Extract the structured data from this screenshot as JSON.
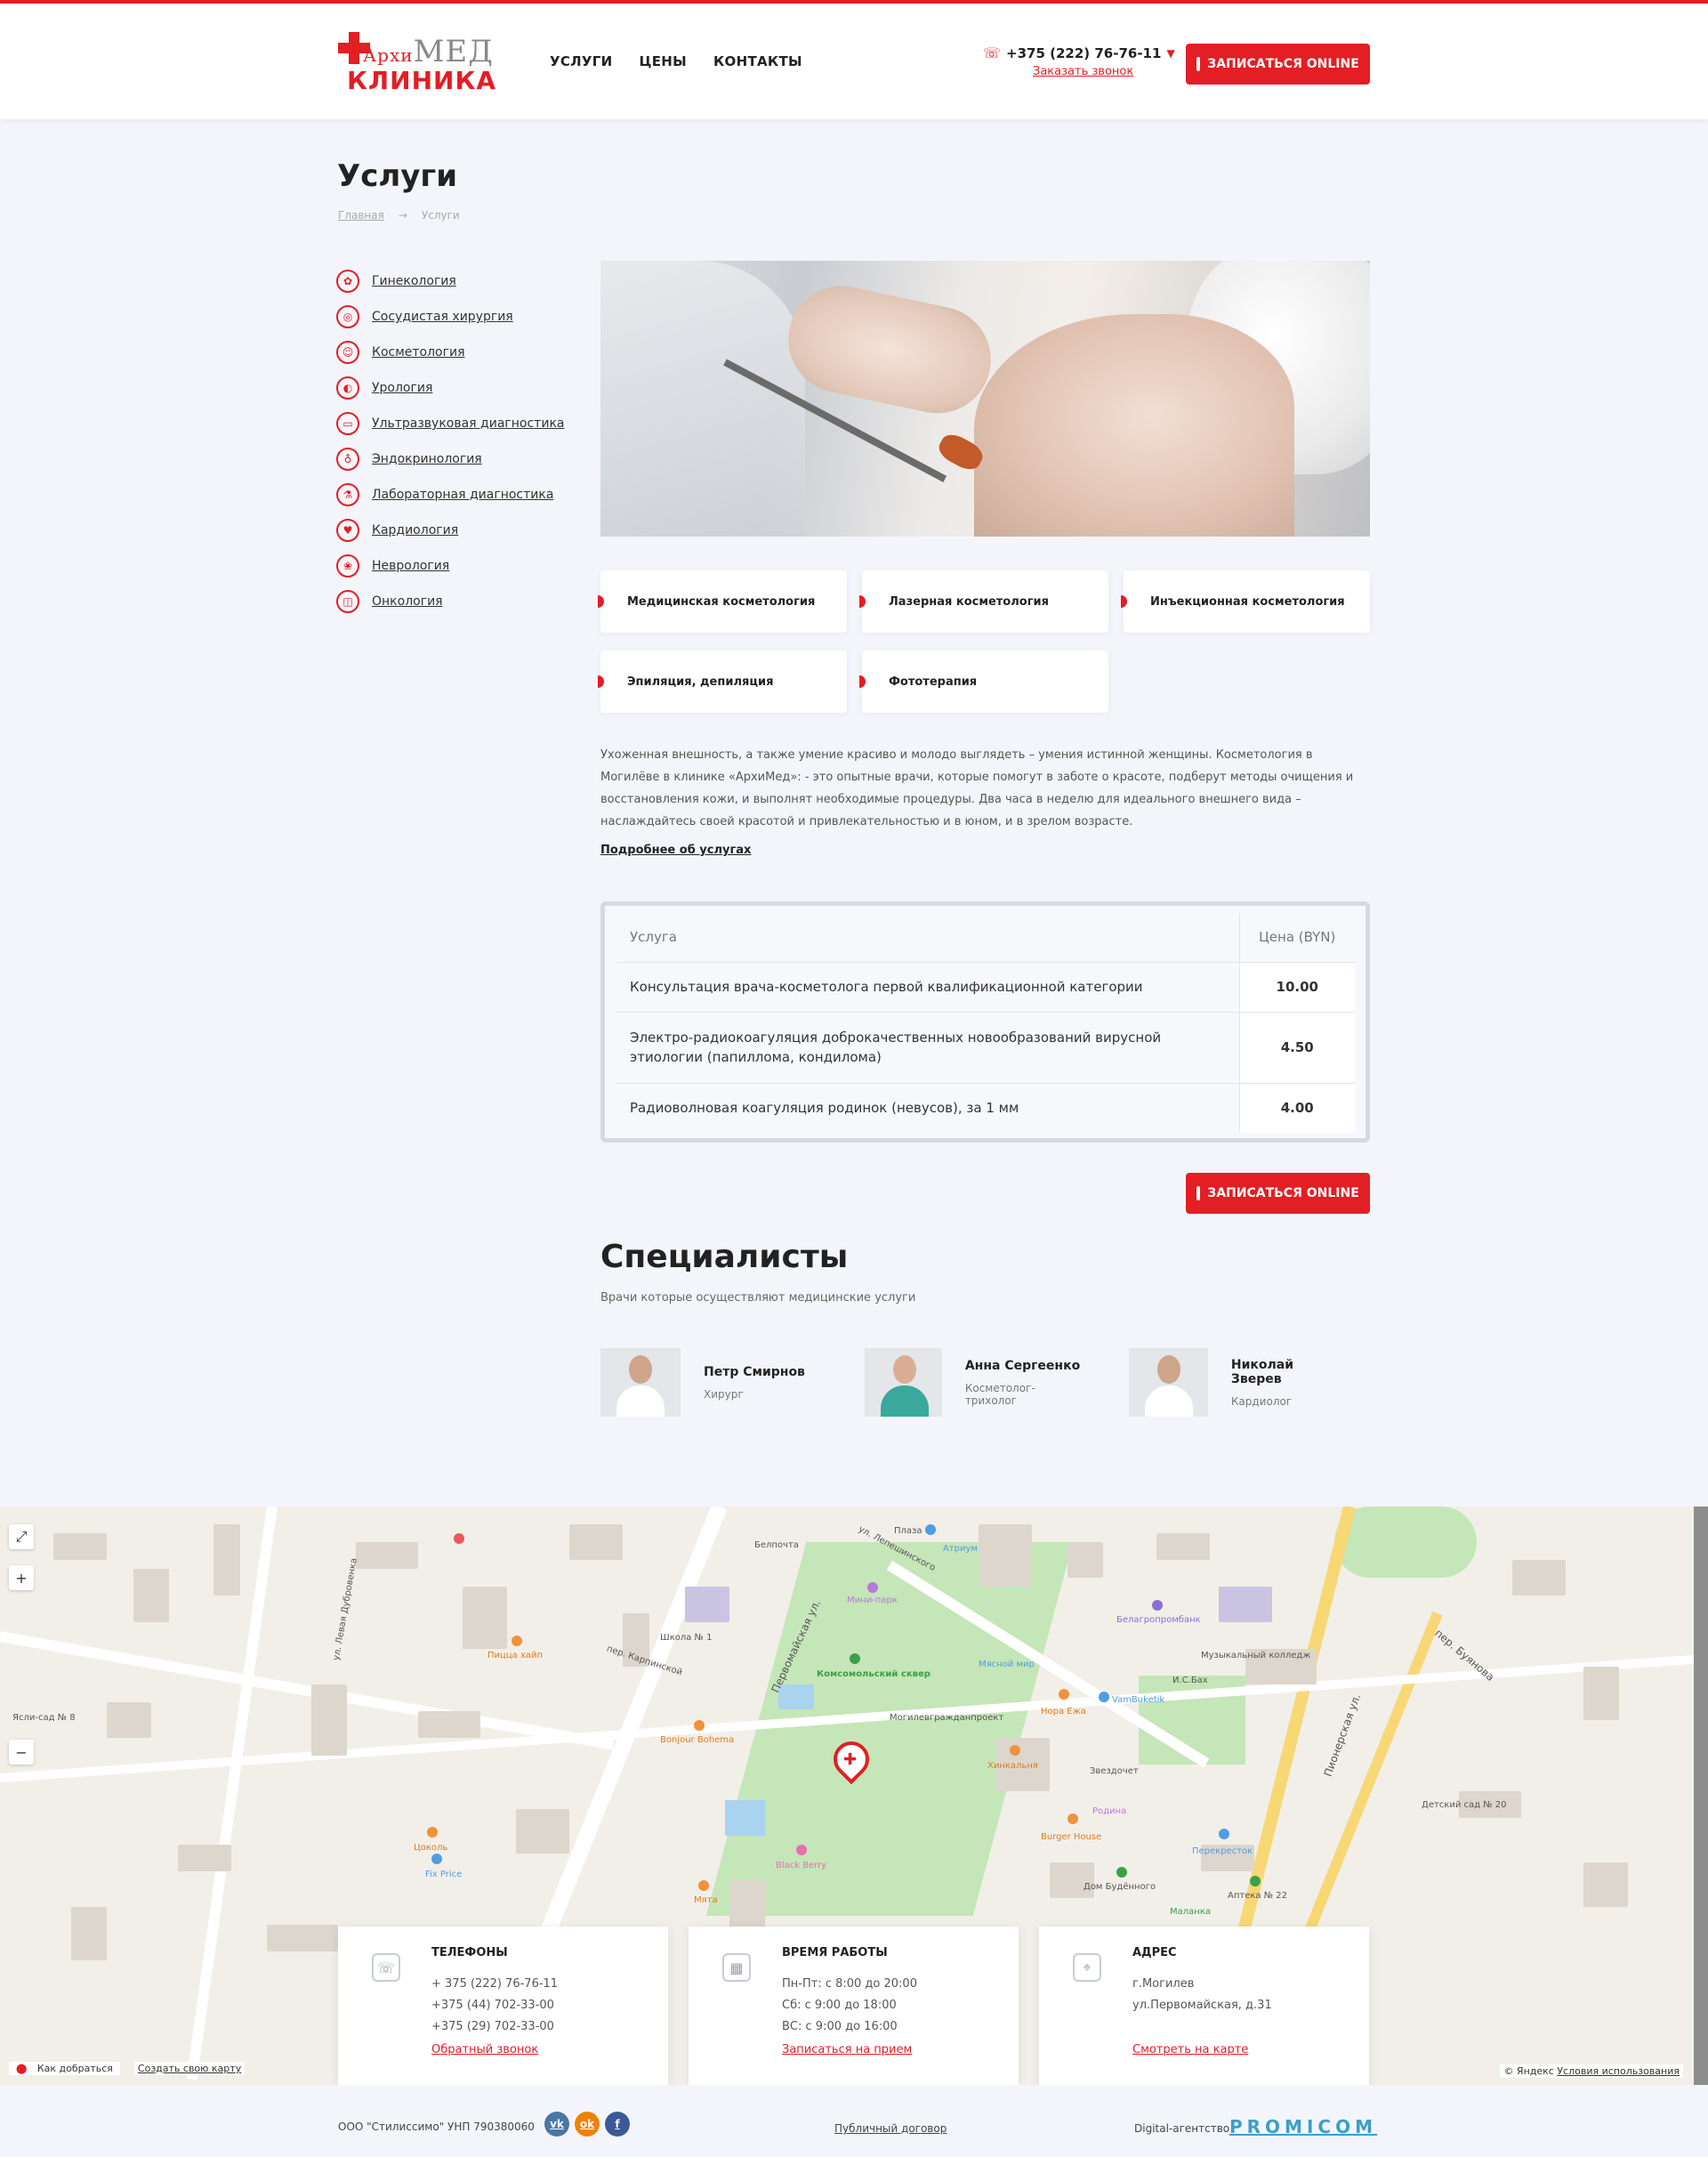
{
  "header": {
    "logo_top": "АрхиМЕД",
    "logo_top_small": "Архи",
    "logo_top_big": "МЕД",
    "logo_bottom": "КЛИНИКА",
    "nav": [
      "УСЛУГИ",
      "ЦЕНЫ",
      "КОНТАКТЫ"
    ],
    "phone": "+375 (222) 76-76-11",
    "callback": "Заказать звонок",
    "cta": "ЗАПИСАТЬСЯ ONLINE"
  },
  "page": {
    "title": "Услуги",
    "breadcrumb": [
      "Главная",
      "Услуги"
    ],
    "breadcrumb_sep": "→"
  },
  "sidebar": [
    {
      "label": "Гинекология",
      "icon": "uterus-icon"
    },
    {
      "label": "Сосудистая хирургия",
      "icon": "vessel-icon"
    },
    {
      "label": "Косметология",
      "icon": "face-icon"
    },
    {
      "label": "Урология",
      "icon": "kidney-icon"
    },
    {
      "label": "Ультразвуковая диагностика",
      "icon": "ultrasound-icon"
    },
    {
      "label": "Эндокринология",
      "icon": "thyroid-icon"
    },
    {
      "label": "Лабораторная диагностика",
      "icon": "microscope-icon"
    },
    {
      "label": "Кардиология",
      "icon": "heart-icon"
    },
    {
      "label": "Неврология",
      "icon": "brain-icon"
    },
    {
      "label": "Онкология",
      "icon": "scan-icon"
    }
  ],
  "subservices": [
    "Медицинская косметология",
    "Лазерная косметология",
    "Инъекционная косметология",
    "Эпиляция, депиляция",
    "Фототерапия"
  ],
  "description": "Ухоженная внешность, а также умение красиво и молодо выглядеть – умения истинной женщины. Косметология в Могилёве в клинике «АрхиМед»: - это опытные врачи, которые помогут в заботе о красоте, подберут методы очищения и восстановления кожи, и выполнят необходимые процедуры. Два часа в неделю для идеального внешнего вида – наслаждайтесь своей красотой и привлекательностью и в юном, и в зрелом возрасте.",
  "more_link": "Подробнее об услугах",
  "price_table": {
    "col_service": "Услуга",
    "col_price": "Цена (BYN)",
    "rows": [
      {
        "service": "Консультация врача-косметолога первой квалификационной категории",
        "price": "10.00"
      },
      {
        "service": "Электро-радиокоагуляция доброкачественных новообразований вирусной этиологии (папиллома, кондилома)",
        "price": "4.50"
      },
      {
        "service": "Радиоволновая коагуляция родинок (невусов), за 1 мм",
        "price": "4.00"
      }
    ]
  },
  "cta_mid": "ЗАПИСАТЬСЯ ONLINE",
  "specialists": {
    "title": "Специалисты",
    "subtitle": "Врачи которые осуществляют медицинские услуги",
    "items": [
      {
        "name": "Петр Смирнов",
        "role": "Хирург"
      },
      {
        "name": "Анна Сергеенко",
        "role": "Косметолог-трихолог"
      },
      {
        "name": "Николай Зверев",
        "role": "Кардиолог"
      }
    ]
  },
  "map": {
    "labels": [
      "Плаза",
      "Атриум",
      "Белпочта",
      "ул. Лепешинского",
      "Мини-парк",
      "Комсомольский сквер",
      "Могилевгражданпроект",
      "Школа № 1",
      "пер. Карпинской",
      "Пицца хайп",
      "Bonjour Bohema",
      "Хинкальня",
      "Звездочет",
      "Нора Ежа",
      "VamBuketik",
      "Музыкальный колледж",
      "Белагропромбанк",
      "Burger House",
      "Перекресток",
      "Black Berry",
      "Цоколь",
      "Fix Price",
      "Мята",
      "Дом Будённого",
      "Маланка",
      "Аптека № 22",
      "Пионерская ул.",
      "пер. Буянова",
      "Первомайская ул.",
      "Мясной мир",
      "И.С.Бах",
      "Родина",
      "Детский сад № 20",
      "Ясли-сад № 8",
      "ул. Левая Дубровенка"
    ],
    "route": "Как добраться",
    "create_map": "Создать свою карту",
    "attribution": "© Яндекс",
    "terms": "Условия использования"
  },
  "contacts": [
    {
      "icon": "phone-icon",
      "title": "ТЕЛЕФОНЫ",
      "lines": [
        "+ 375 (222) 76-76-11",
        "+375 (44) 702-33-00",
        "+375 (29) 702-33-00"
      ],
      "link": "Обратный звонок"
    },
    {
      "icon": "calendar-icon",
      "title": "ВРЕМЯ РАБОТЫ",
      "lines": [
        "Пн-Пт: с 8:00 до 20:00",
        "Сб: с 9:00 до 18:00",
        "ВС: с 9:00 до 16:00"
      ],
      "link": "Записаться на прием"
    },
    {
      "icon": "location-icon",
      "title": "АДРЕС",
      "lines": [
        "г.Могилев",
        "ул.Первомайская, д.31"
      ],
      "link": "Смотреть на карте"
    }
  ],
  "footer": {
    "company": "ООО \"Стилиссимо\" УНП 790380060",
    "socials": [
      {
        "name": "vk-icon",
        "glyph": "vk",
        "color": "#4a76a8"
      },
      {
        "name": "ok-icon",
        "glyph": "ok",
        "color": "#ee8208"
      },
      {
        "name": "facebook-icon",
        "glyph": "f",
        "color": "#3b5998"
      }
    ],
    "contract": "Публичный договор",
    "agency": "Digital-агентство",
    "agency_brand": "PROMICOM"
  },
  "colors": {
    "accent": "#e31e24",
    "background": "#f4f5fb"
  }
}
